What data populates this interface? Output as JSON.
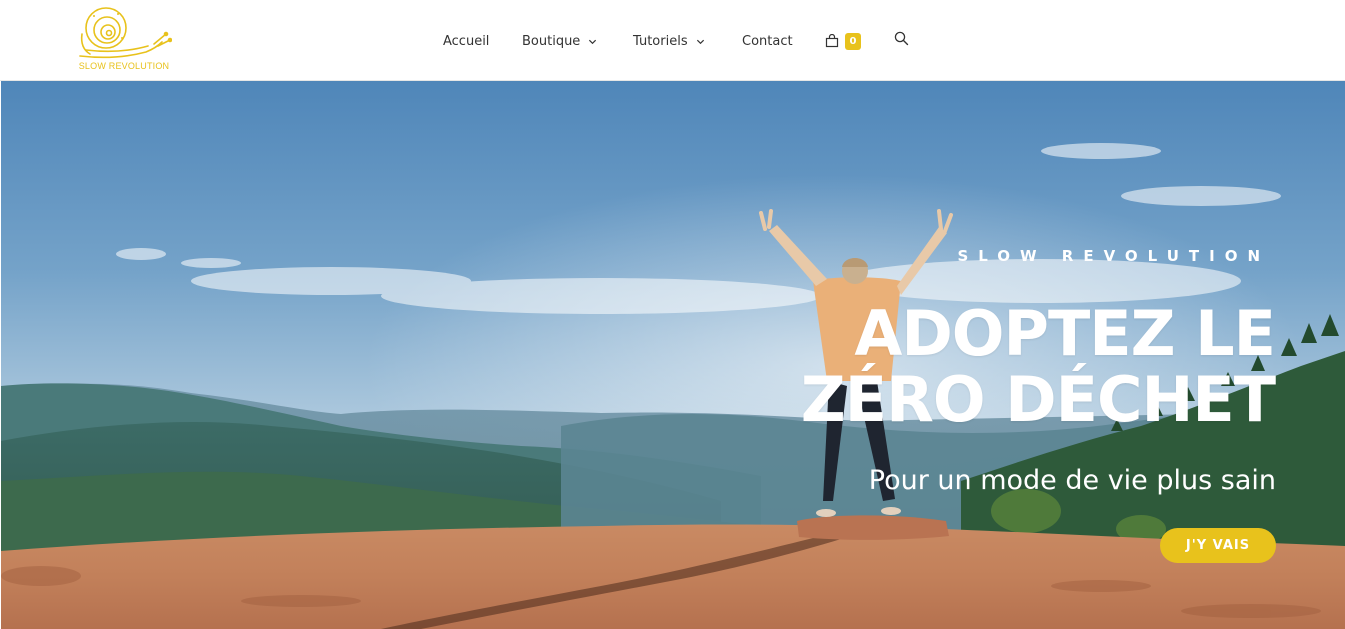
{
  "brand": {
    "name": "SLOW REVOLUTION",
    "accent_color": "#e8c21c",
    "logo_icon": "snail-icon"
  },
  "nav": {
    "items": [
      {
        "label": "Accueil",
        "has_dropdown": false
      },
      {
        "label": "Boutique",
        "has_dropdown": true
      },
      {
        "label": "Tutoriels",
        "has_dropdown": true
      },
      {
        "label": "Contact",
        "has_dropdown": false
      }
    ],
    "cart": {
      "icon": "shopping-bag-icon",
      "count": "0"
    },
    "search": {
      "icon": "search-icon"
    }
  },
  "hero": {
    "kicker": "SLOW REVOLUTION",
    "title": "ADOPTEZ LE ZÉRO DÉCHET",
    "subtitle": "Pour un mode de vie plus sain",
    "cta_label": "J'Y VAIS",
    "cta_color": "#e8c21c"
  }
}
